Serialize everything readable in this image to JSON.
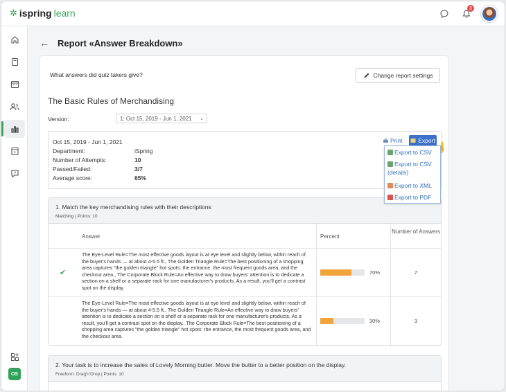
{
  "app": {
    "logo_brand": "ispring",
    "logo_product": "learn",
    "notification_count": "3"
  },
  "sidebar": {
    "user_initials": "OS"
  },
  "page": {
    "title": "Report «Answer Breakdown»"
  },
  "report": {
    "question_prompt": "What answers did quiz takers give?",
    "change_settings_label": "Change report settings",
    "quiz_title": "The Basic Rules of Merchandising",
    "version_label": "Version:",
    "version_value": "1: Oct 15, 2019 - Jun 1, 2021"
  },
  "info": {
    "date_range": "Oct 15, 2019 - Jun 1, 2021",
    "rows": [
      {
        "label": "Department:",
        "value": "iSpring"
      },
      {
        "label": "Number of Attempts:",
        "value": "10"
      },
      {
        "label": "Passed/Failed:",
        "value": "3/7"
      },
      {
        "label": "Average score:",
        "value": "65%"
      }
    ],
    "print_label": "Print",
    "export_label": "Export"
  },
  "export_menu": {
    "items": [
      "Export to CSV",
      "Export to CSV (details)",
      "Export to XML",
      "Export to PDF"
    ]
  },
  "questions": [
    {
      "title": "1. Match the key merchandising rules with their descriptions",
      "meta": "Matching | Points: 10",
      "columns": {
        "answer": "Answer",
        "percent": "Percent",
        "count": "Number of Answers"
      },
      "answers": [
        {
          "correct": true,
          "text": "The Eye-Level Rule=The most effective goods layout is at eye level and slightly below, within reach of the buyer's hands — at about 4-5.5 ft., The Golden Triangle Rule=The best positioning of a shopping area captures \"the golden triangle\" hot spots: the entrance, the most frequent goods area, and the checkout area., The Corporate Block Rule=An effective way to draw buyers' attention is to dedicate a section on a shelf or a separate rack for one manufacturer's products. As a result, you'll get a contrast spot on the display.",
          "percent_value": 70,
          "percent": "70%",
          "count": "7"
        },
        {
          "correct": false,
          "text": "The Eye-Level Rule=The most effective goods layout is at eye level and slightly below, within reach of the buyer's hands — at about 4-5.5 ft., The Golden Triangle Rule=An effective way to draw buyers' attention is to dedicate a section on a shelf or a separate rack for one manufacturer's products. As a result, you'll get a contrast spot on the display., The Corporate Block Rule=The best positioning of a shopping area captures \"the golden triangle\" hot spots: the entrance, the most frequent goods area, and the checkout area.",
          "percent_value": 30,
          "percent": "30%",
          "count": "3"
        }
      ]
    },
    {
      "title": "2. Your task is to increase the sales of Lovely Morning butter. Move the butter to a better position on the display.",
      "meta": "Freeform: Drag'n'Drop | Points: 10"
    }
  ],
  "colors": {
    "brand": "#3aa757",
    "accent": "#3b71c9",
    "bar_fill": "#f0a43a"
  }
}
